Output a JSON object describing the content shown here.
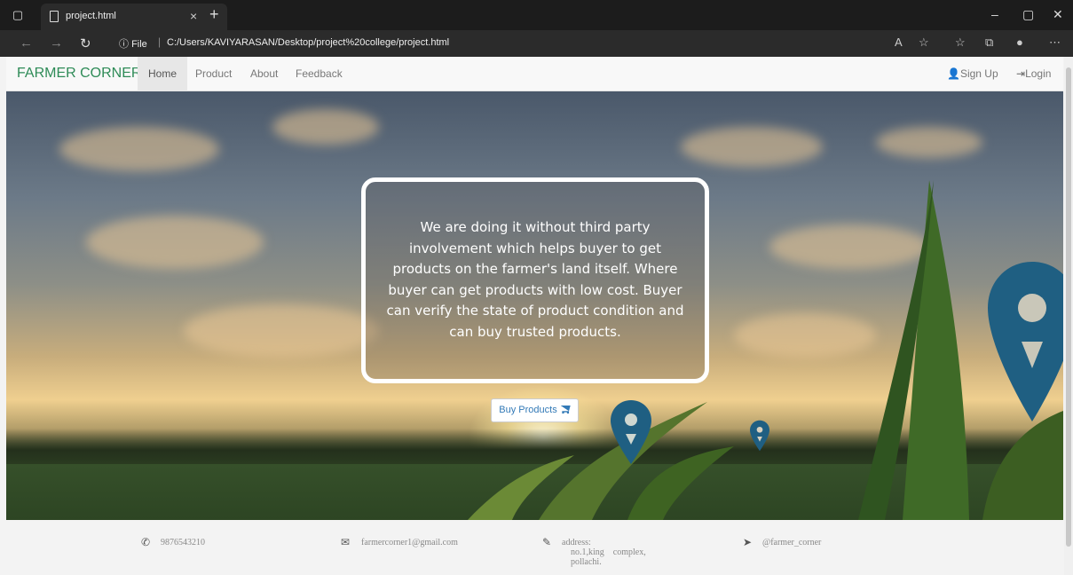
{
  "browser": {
    "tab_title": "project.html",
    "url_scheme_label": "File",
    "url": "C:/Users/KAVIYARASAN/Desktop/project%20college/project.html"
  },
  "navbar": {
    "brand": "FARMER CORNER",
    "links": [
      "Home",
      "Product",
      "About",
      "Feedback"
    ],
    "active_link": "Home",
    "signup": "Sign Up",
    "login": "Login"
  },
  "hero": {
    "message": "We are doing it without third party involvement which helps buyer to get products on the farmer's land itself. Where buyer can get products with low cost. Buyer can verify the state of product condition and can buy trusted products.",
    "buy_button": "Buy Products",
    "pin_color": "#1f5f82"
  },
  "footer": {
    "phone": "9876543210",
    "email": "farmercorner1@gmail.com",
    "address_label": "address:",
    "address_line1": "no.1,king    complex,",
    "address_line2": "pollachi.",
    "social": "@farmer_corner"
  },
  "colors": {
    "brand": "#2e8b57",
    "link_blue": "#337ab7"
  }
}
